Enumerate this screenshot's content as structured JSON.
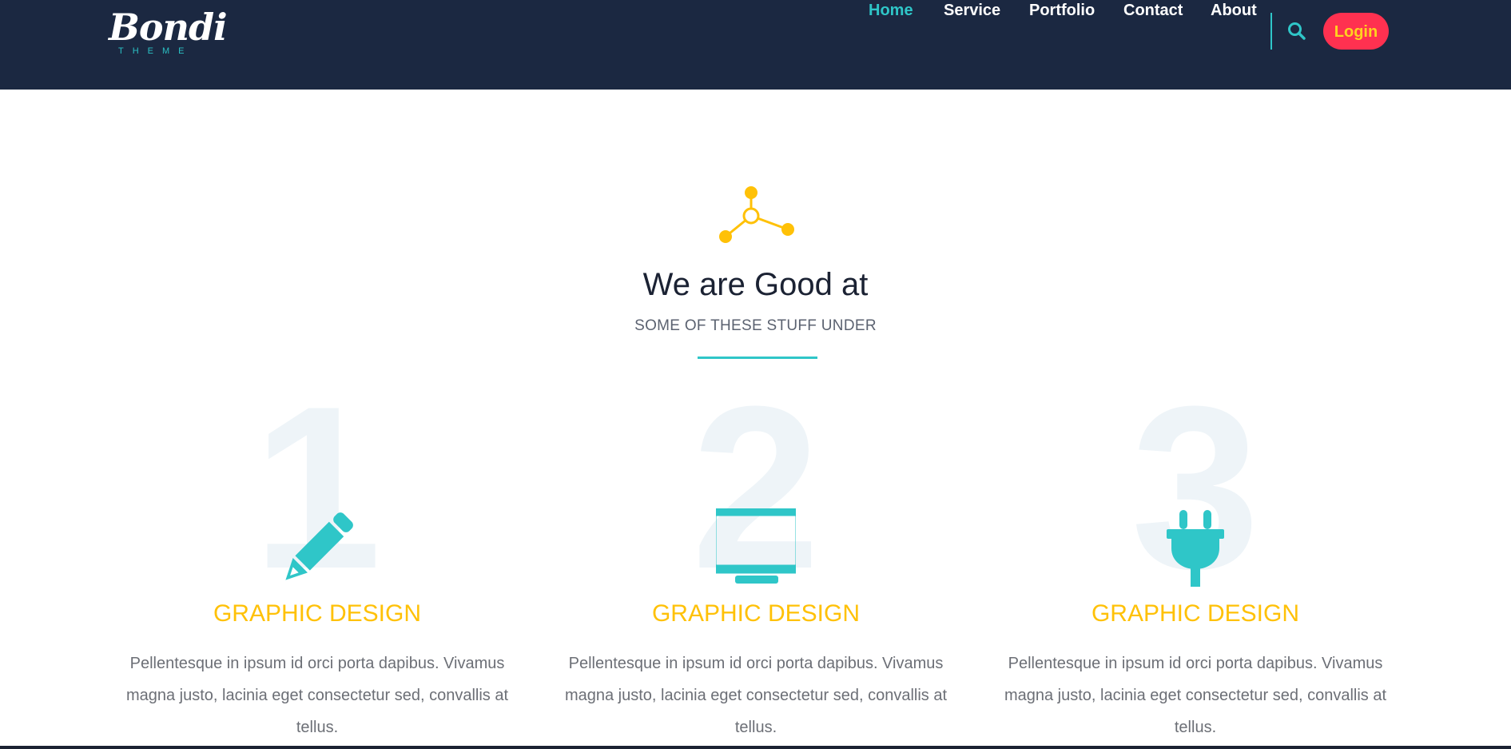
{
  "header": {
    "logo_text": "Bondi",
    "logo_subtext": "THEME",
    "nav": [
      {
        "label": "Home",
        "active": true
      },
      {
        "label": "Service",
        "active": false
      },
      {
        "label": "Portfolio",
        "active": false
      },
      {
        "label": "Contact",
        "active": false
      },
      {
        "label": "About",
        "active": false
      }
    ],
    "search_icon": "search-icon",
    "login_label": "Login"
  },
  "section": {
    "icon": "molecule-icon",
    "title": "We are Good at",
    "subtitle": "SOME OF THESE STUFF UNDER"
  },
  "services": [
    {
      "number": "1",
      "icon": "pencil-icon",
      "title": "GRAPHIC DESIGN",
      "text": "Pellentesque in ipsum id orci porta dapibus. Vivamus magna justo, lacinia eget consectetur sed, convallis at tellus."
    },
    {
      "number": "2",
      "icon": "monitor-icon",
      "title": "GRAPHIC DESIGN",
      "text": "Pellentesque in ipsum id orci porta dapibus. Vivamus magna justo, lacinia eget consectetur sed, convallis at tellus."
    },
    {
      "number": "3",
      "icon": "plug-icon",
      "title": "GRAPHIC DESIGN",
      "text": "Pellentesque in ipsum id orci porta dapibus. Vivamus magna justo, lacinia eget consectetur sed, convallis at tellus."
    }
  ],
  "colors": {
    "header_bg": "#1b2841",
    "accent_teal": "#2fc6c8",
    "accent_yellow": "#ffc107",
    "login_bg": "#ff3150",
    "login_text": "#ffd21f"
  }
}
